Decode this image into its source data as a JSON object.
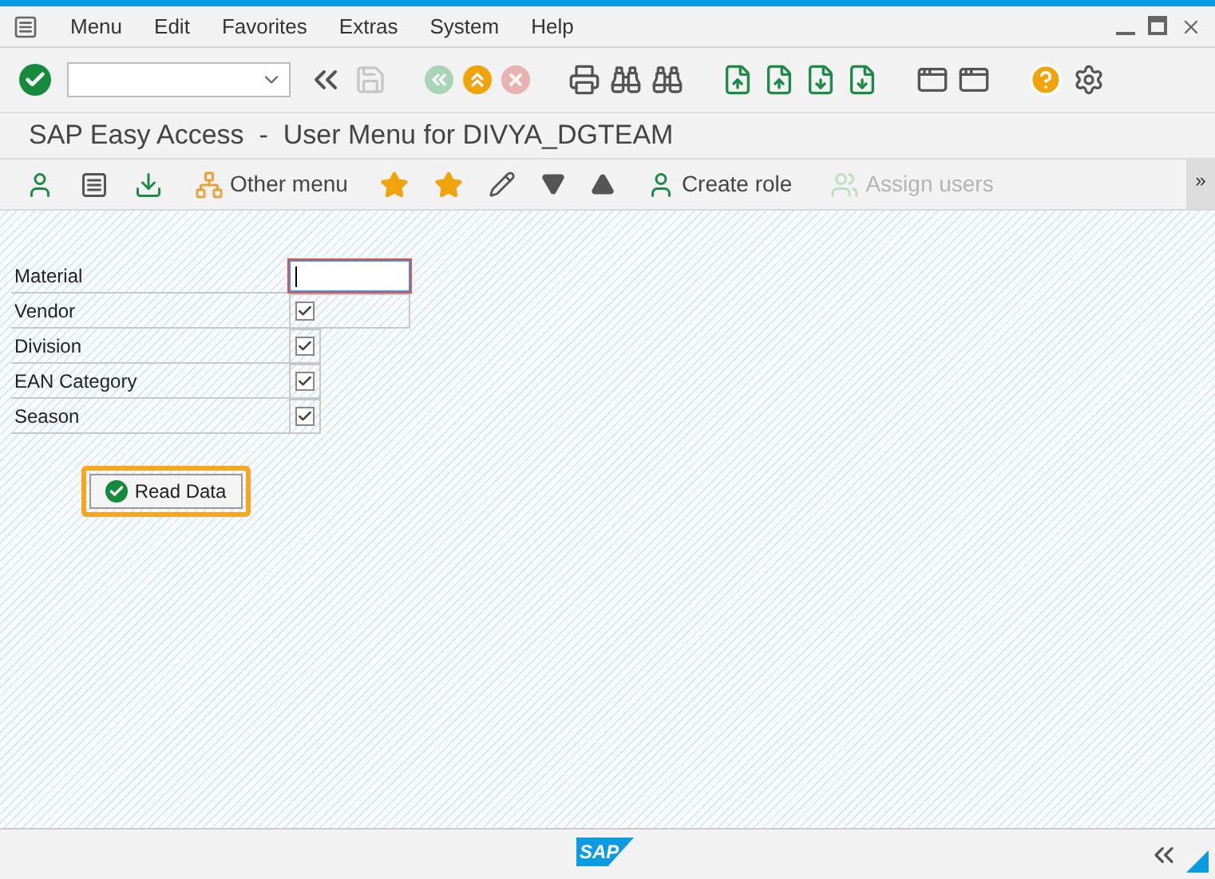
{
  "menu_bar": {
    "items": [
      "Menu",
      "Edit",
      "Favorites",
      "Extras",
      "System",
      "Help"
    ]
  },
  "toolbar": {
    "buttons": [
      {
        "disabled": false
      },
      {
        "disabled": false
      },
      {
        "disabled": true
      },
      {
        "disabled": true
      },
      {
        "disabled": false
      },
      {
        "disabled": true
      },
      {
        "disabled": false
      },
      {
        "disabled": false
      },
      {
        "disabled": false
      },
      {
        "disabled": false
      },
      {
        "disabled": false
      },
      {
        "disabled": false
      },
      {
        "disabled": false
      },
      {
        "disabled": false
      },
      {
        "disabled": false
      },
      {
        "disabled": false
      },
      {
        "disabled": false
      }
    ]
  },
  "title": "SAP Easy Access  -  User Menu for DIVYA_DGTEAM",
  "app_toolbar": {
    "items": [
      {
        "disabled": false
      },
      {
        "disabled": false
      },
      {
        "disabled": false
      },
      {
        "label": "Other menu",
        "disabled": false
      },
      {
        "disabled": false
      },
      {
        "disabled": false
      },
      {
        "disabled": false
      },
      {
        "disabled": false
      },
      {
        "disabled": false
      },
      {
        "label": "Create role",
        "disabled": false
      },
      {
        "label": "Assign users",
        "disabled": true
      }
    ],
    "more": "»"
  },
  "form": {
    "rows": [
      {
        "label": "Material",
        "kind": "input"
      },
      {
        "label": "Vendor",
        "kind": "wide-checkbox",
        "checked": true
      },
      {
        "label": "Division",
        "kind": "checkbox",
        "checked": true
      },
      {
        "label": "EAN Category",
        "kind": "checkbox",
        "checked": true
      },
      {
        "label": "Season",
        "kind": "checkbox",
        "checked": true
      }
    ],
    "button": "Read Data"
  },
  "status_bar": {
    "logo": "SAP"
  }
}
